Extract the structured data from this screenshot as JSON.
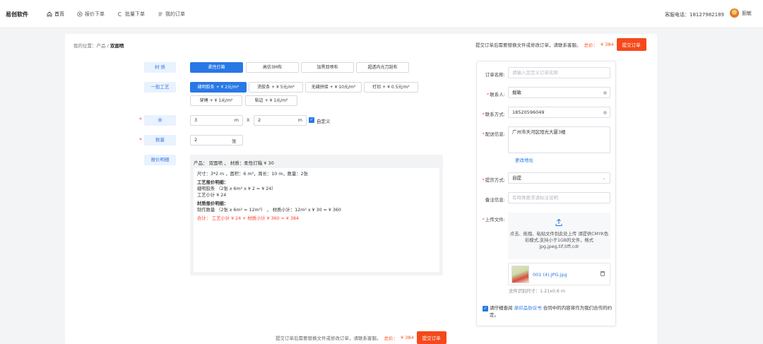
{
  "header": {
    "brand": "易创软件",
    "nav": [
      {
        "label": "首页",
        "icon": "home-icon",
        "active": true
      },
      {
        "label": "报价下单",
        "icon": "yen-icon",
        "active": false
      },
      {
        "label": "批量下单",
        "icon": "batch-icon",
        "active": false
      },
      {
        "label": "我的订单",
        "icon": "list-icon",
        "active": false
      }
    ],
    "hotline": "客服电话：18127982189",
    "user_name": "掘敏"
  },
  "breadcrumb": {
    "prefix": "我的位置：产品 / ",
    "current": "双面喷"
  },
  "top_actions": {
    "notice": "提交订单后需要替换文件或修改订单，请联系客服。",
    "total_label": "总价：",
    "total_value": "¥ 384",
    "submit": "提交订单"
  },
  "form": {
    "material_label": "材 质",
    "materials": [
      "柔性灯箱",
      "高仿3M布",
      "加黑双喷布",
      "超透内光刀刮布"
    ],
    "material_selected": 0,
    "process_label": "一般工艺",
    "processes": [
      "缝明胶条 + ¥ 2元/m²",
      "烫胶条 + ¥ 5元/m²",
      "无缝拼接 + ¥ 10元/m²",
      "打扣 + ¥ 0.5元/m²",
      "穿绳 + ¥ 1元/m²",
      "粘边 + ¥ 1元/m²"
    ],
    "process_selected": 0,
    "size_label": "米",
    "width": "3",
    "height": "2",
    "unit_m": "m",
    "times": "X",
    "custom": "自定义",
    "qty_label": "数量",
    "qty": "2",
    "qty_unit": "张",
    "quote_label": "报价明细"
  },
  "quote": {
    "head": "产品：  双面喷 ，  材质：柔性灯箱 ¥ 30",
    "lines": [
      {
        "text": "尺寸：3*2 m ，面积：6 m²，周长：10 m，数量：2张",
        "type": "normal"
      },
      {
        "text": "工艺报价明细：",
        "type": "sec"
      },
      {
        "text": "缝明胶条   （2张 x 6m² x ¥ 2 = ¥ 24）",
        "type": "normal"
      },
      {
        "text": "工艺小计 ¥ 24",
        "type": "normal"
      },
      {
        "text": "材质报价明细：",
        "type": "sec"
      },
      {
        "text": "制作数量   （2张 x 6m² = 12m²） ，  材质小计：12m² x ¥ 30 = ¥ 360",
        "type": "normal"
      },
      {
        "text": "合计：  工艺小计 ¥ 24 + 材质小计 ¥ 360 = ¥ 384",
        "type": "total"
      }
    ]
  },
  "order": {
    "name_label": "订单名称:",
    "name_placeholder": "请输入您定义订单名称",
    "contact_label": "联系人:",
    "contact_value": "掘敏",
    "phone_label": "联系方式:",
    "phone_value": "18520596049",
    "address_label": "配送信息:",
    "address_value": "广州市天河区阳光大厦3楼",
    "change_address": "更改地址",
    "ship_label": "提货方式:",
    "ship_value": "自提",
    "note_label": "备注信息:",
    "note_placeholder": "有特殊要求请标注说明",
    "upload_label": "上传文件:",
    "upload_text": "点击、拖拽、粘贴文件到此处上传 请提供CMYK色彩模式,支持小于1GB的文件，格式jpg,jpeg,tif,tiff,cdr",
    "file_name": "001 (4).JPG.jpg",
    "file_size": "文件识别尺寸：1.21x0.6 m",
    "agree_prefix": "请仔细查阅",
    "agree_link": "承印品协议书",
    "agree_suffix": "合同中的内容将作为我们合作的约定。"
  },
  "bottom": {
    "notice": "提交订单后需要替换文件或修改订单，请联系客服。",
    "total_label": "总价：",
    "total_value": "¥ 384",
    "submit": "提交订单"
  }
}
